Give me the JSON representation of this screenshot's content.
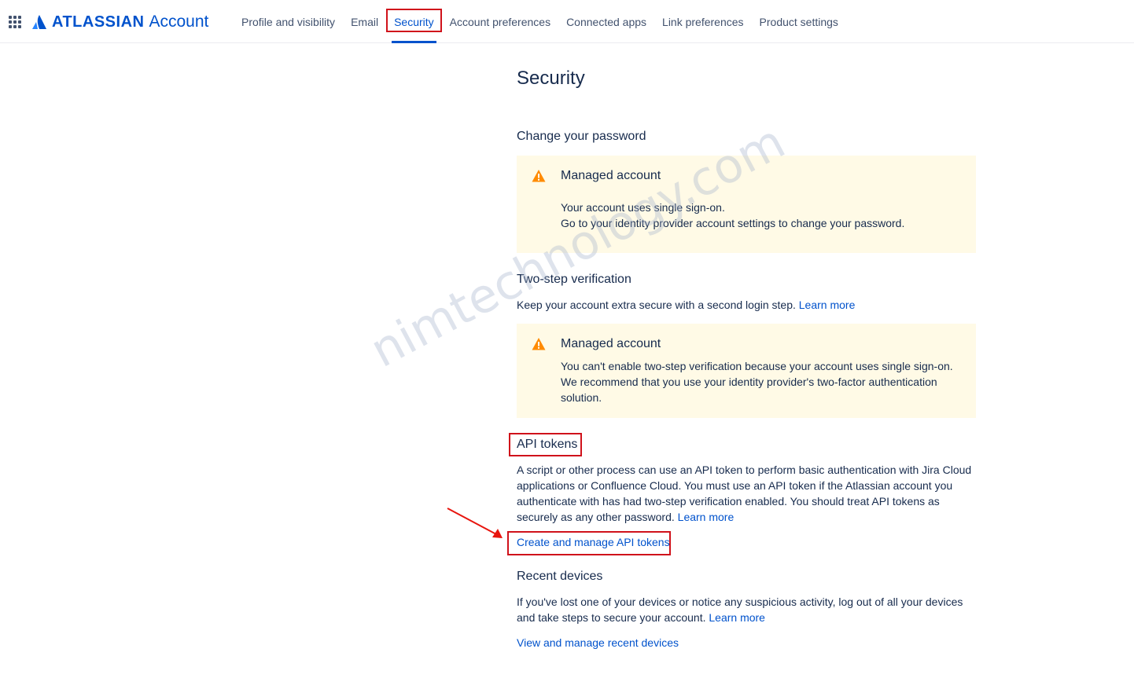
{
  "header": {
    "brand": "ATLASSIAN",
    "product": "Account",
    "tabs": [
      {
        "label": "Profile and visibility"
      },
      {
        "label": "Email"
      },
      {
        "label": "Security"
      },
      {
        "label": "Account preferences"
      },
      {
        "label": "Connected apps"
      },
      {
        "label": "Link preferences"
      },
      {
        "label": "Product settings"
      }
    ],
    "active_tab": "Security"
  },
  "page": {
    "title": "Security",
    "password": {
      "heading": "Change your password",
      "notice_title": "Managed account",
      "notice_line1": "Your account uses single sign-on.",
      "notice_line2": "Go to your identity provider account settings to change your password."
    },
    "two_step": {
      "heading": "Two-step verification",
      "desc": "Keep your account extra secure with a second login step.",
      "learn_more": "Learn more",
      "notice_title": "Managed account",
      "notice_line1": "You can't enable two-step verification because your account uses single sign-on.",
      "notice_line2": "We recommend that you use your identity provider's two-factor authentication solution."
    },
    "api_tokens": {
      "heading": "API tokens",
      "desc": "A script or other process can use an API token to perform basic authentication with Jira Cloud applications or Confluence Cloud. You must use an API token if the Atlassian account you authenticate with has had two-step verification enabled. You should treat API tokens as securely as any other password.",
      "learn_more": "Learn more",
      "link": "Create and manage API tokens"
    },
    "recent_devices": {
      "heading": "Recent devices",
      "desc": "If you've lost one of your devices or notice any suspicious activity, log out of all your devices and take steps to secure your account.",
      "learn_more": "Learn more",
      "link": "View and manage recent devices"
    }
  },
  "watermark": "nimtechnology.com",
  "colors": {
    "accent": "#0052cc",
    "warning_bg": "#fffae6",
    "warning_icon": "#ff8b00",
    "annotation_red": "#d0121b"
  }
}
